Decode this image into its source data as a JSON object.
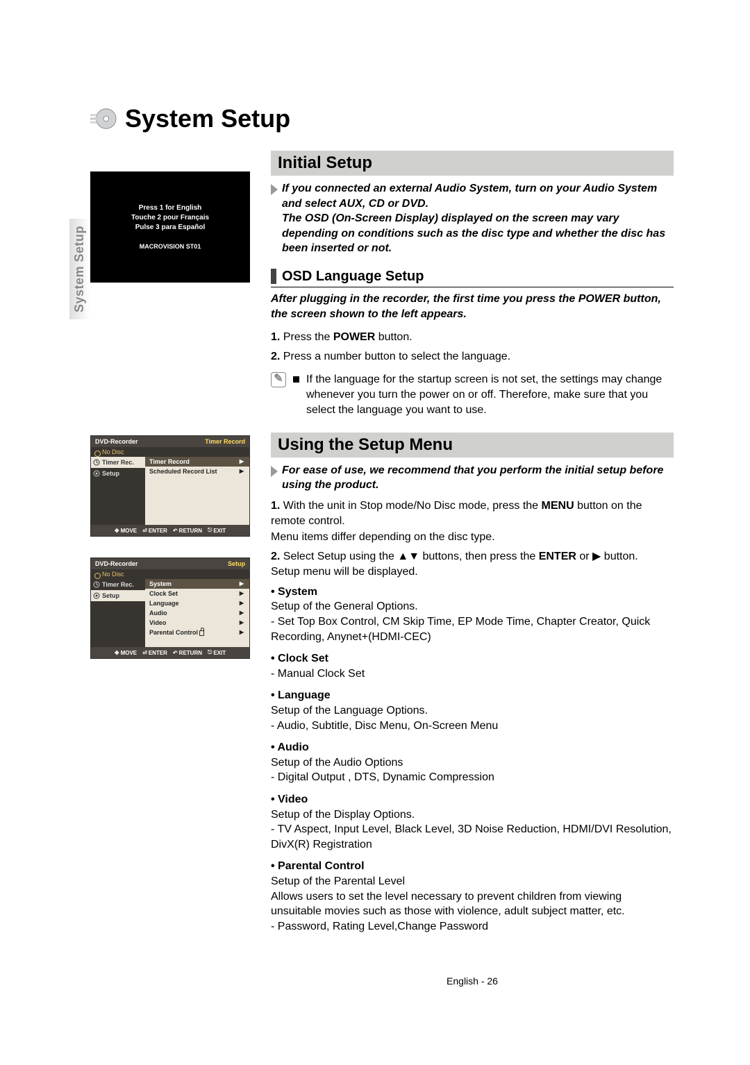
{
  "title": "System Setup",
  "vtab": "System Setup",
  "lang_box": {
    "line1": "Press 1 for English",
    "line2": "Touche 2 pour Français",
    "line3": "Pulse 3 para Español",
    "footer": "MACROVISION ST01"
  },
  "initial": {
    "heading": "Initial Setup",
    "intro": "If you connected an external Audio System, turn on your Audio System and select AUX, CD or DVD.\nThe OSD (On-Screen Display) displayed on the screen may vary depending on conditions such as the disc type and whether the disc has been inserted or not.",
    "osd_heading": "OSD Language Setup",
    "osd_intro": "After plugging in the recorder, the first time you press the POWER button, the screen shown to the left appears.",
    "step1_num": "1.",
    "step1_a": "Press the ",
    "step1_b": "POWER",
    "step1_c": " button.",
    "step2_num": "2.",
    "step2": "Press a number button to select the language.",
    "note": "If the language for the startup screen is not set, the settings may change whenever you turn the power on or off. Therefore, make sure that you select the language you want to use."
  },
  "using": {
    "heading": "Using the Setup Menu",
    "intro": "For ease of use, we recommend that you perform the initial setup before using the product.",
    "step1_num": "1.",
    "step1_a": "With the unit in Stop mode/No Disc mode, press the ",
    "step1_b": "MENU",
    "step1_c": " button on the remote control.\nMenu items differ depending on the disc type.",
    "step2_num": "2.",
    "step2_a": "Select Setup using the ▲▼ buttons, then press the ",
    "step2_b": "ENTER",
    "step2_c": " or ▶ button.\nSetup menu will be displayed.",
    "opts": [
      {
        "name": "System",
        "l1": "Setup of the General Options.",
        "l2": "- Set Top Box Control, CM Skip Time, EP Mode Time, Chapter Creator, Quick Recording, Anynet+(HDMI-CEC)"
      },
      {
        "name": "Clock Set",
        "l1": "- Manual Clock Set",
        "l2": ""
      },
      {
        "name": "Language",
        "l1": "Setup of the Language Options.",
        "l2": "- Audio, Subtitle, Disc Menu, On-Screen Menu"
      },
      {
        "name": "Audio",
        "l1": "Setup of the Audio Options",
        "l2": "- Digital Output , DTS, Dynamic Compression"
      },
      {
        "name": "Video",
        "l1": "Setup of the Display Options.",
        "l2": "- TV Aspect, Input Level, Black Level, 3D Noise Reduction, HDMI/DVI Resolution, DivX(R) Registration"
      },
      {
        "name": "Parental Control",
        "l1": "Setup of the Parental Level",
        "l2": "Allows users to set the level necessary to prevent children from viewing unsuitable movies such as those with violence, adult subject matter, etc.\n- Password, Rating Level,Change Password"
      }
    ]
  },
  "shots": {
    "common": {
      "app": "DVD-Recorder",
      "nodisc": "No Disc",
      "foot_move": "MOVE",
      "foot_enter": "ENTER",
      "foot_return": "RETURN",
      "foot_exit": "EXIT"
    },
    "s1": {
      "hl": "Timer Record",
      "side1": "Timer Rec.",
      "side2": "Setup",
      "rows": [
        "Timer Record",
        "Scheduled Record List"
      ]
    },
    "s2": {
      "hl": "Setup",
      "side1": "Timer Rec.",
      "side2": "Setup",
      "rows": [
        "System",
        "Clock Set",
        "Language",
        "Audio",
        "Video"
      ],
      "row_lock": "Parental Control"
    }
  },
  "footer": "English - 26"
}
